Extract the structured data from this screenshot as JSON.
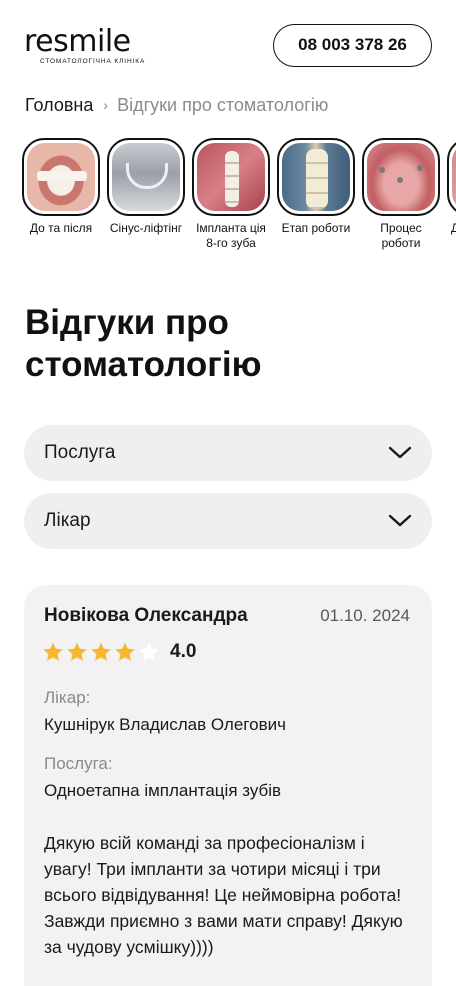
{
  "header": {
    "logo_text": "resmile",
    "logo_subtitle": "СТОМАТОЛОГІЧНА КЛІНІКА",
    "phone": "08 003 378 26"
  },
  "breadcrumb": {
    "home": "Головна",
    "separator": "›",
    "current": "Відгуки про стоматологію"
  },
  "stories": [
    {
      "label": "До та після",
      "icon": "smile-teeth-photo"
    },
    {
      "label": "Сінус-ліфтінг",
      "icon": "xray-photo"
    },
    {
      "label": "Імпланта ція 8-го зуба",
      "icon": "implant-photo"
    },
    {
      "label": "Етап роботи",
      "icon": "crowns-photo"
    },
    {
      "label": "Процес роботи",
      "icon": "implants-jaw-photo"
    },
    {
      "label": "Д",
      "icon": "partial-photo"
    }
  ],
  "page_title": "Відгуки про стоматологію",
  "filters": {
    "service": "Послуга",
    "doctor": "Лікар"
  },
  "review": {
    "author": "Новікова Олександра",
    "date": "01.10. 2024",
    "stars_filled": 4,
    "stars_total": 5,
    "rating": "4.0",
    "doctor_label": "Лікар:",
    "doctor_value": "Кушнірук Владислав Олегович",
    "service_label": "Послуга:",
    "service_value": "Одноетапна імплантація зубів",
    "text": "Дякую всій команді за професіоналізм і увагу! Три імпланти за чотири місяці і три всього відвідування! Це неймовірна робота! Завжди приємно з вами мати справу! Дякую за чудову усмішку))))"
  },
  "colors": {
    "star_filled": "#f7b733",
    "star_empty": "#ffffff",
    "card_bg": "#f2f2f3",
    "select_bg": "#efeff0",
    "muted_text": "#8b8b8b"
  }
}
